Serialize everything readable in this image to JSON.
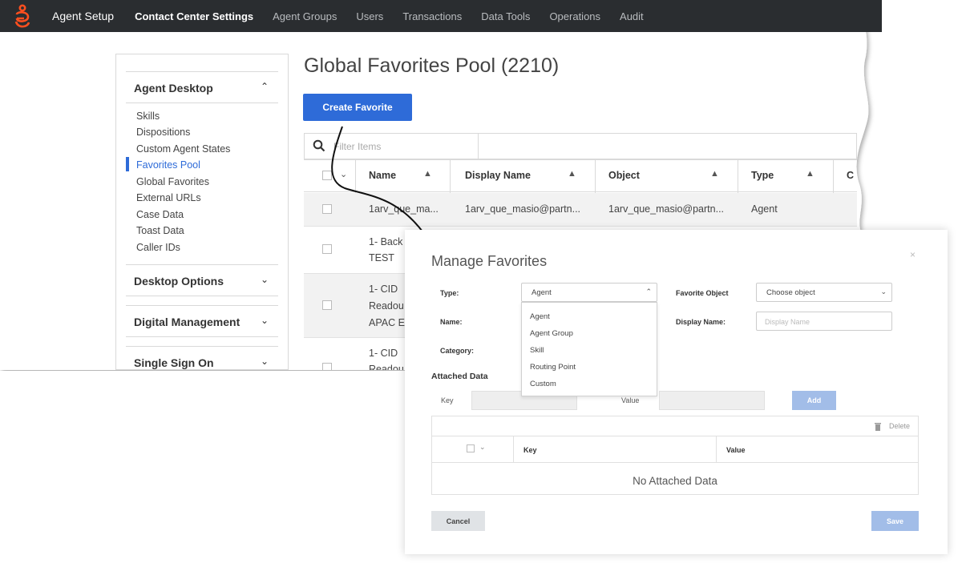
{
  "topbar": {
    "app_name": "Agent Setup",
    "items": [
      "Contact Center Settings",
      "Agent Groups",
      "Users",
      "Transactions",
      "Data Tools",
      "Operations",
      "Audit"
    ],
    "background": "#2a2d30",
    "logo_color": "#ff4f1f"
  },
  "sidebar": {
    "section_agent_desktop": "Agent Desktop",
    "items": [
      "Skills",
      "Dispositions",
      "Custom Agent States",
      "Favorites Pool",
      "Global Favorites",
      "External URLs",
      "Case Data",
      "Toast Data",
      "Caller IDs"
    ],
    "active_item": "Favorites Pool",
    "section_desktop_options": "Desktop Options",
    "section_digital_management": "Digital Management",
    "section_single_sign_on": "Single Sign On",
    "accent": "#2e6bd8"
  },
  "main": {
    "title": "Global Favorites Pool (2210)",
    "create_button": "Create Favorite",
    "filter_placeholder": "Filter Items",
    "columns": [
      "Name",
      "Display Name",
      "Object",
      "Type",
      "C"
    ],
    "rows": [
      {
        "name": "1arv_que_ma...",
        "display_name": "1arv_que_masio@partn...",
        "object": "1arv_que_masio@partn...",
        "type": "Agent"
      },
      {
        "name_l1": "1- Back",
        "name_l2": "TEST"
      },
      {
        "name_l1": "1- CID",
        "name_l2": "Readou",
        "name_l3": "APAC EI"
      },
      {
        "name_l1": "1- CID",
        "name_l2": "Readou"
      }
    ]
  },
  "modal": {
    "title": "Manage Favorites",
    "close": "×",
    "type_label": "Type:",
    "type_value": "Agent",
    "favorite_object_label": "Favorite Object",
    "favorite_object_value": "Choose object",
    "name_label": "Name:",
    "display_name_label": "Display Name:",
    "display_name_placeholder": "Display Name",
    "category_label": "Category:",
    "type_options": [
      "Agent",
      "Agent Group",
      "Skill",
      "Routing Point",
      "Custom"
    ],
    "attached_data_title": "Attached Data",
    "key_label": "Key",
    "value_label": "Value",
    "add_button": "Add",
    "delete_label": "Delete",
    "table_key": "Key",
    "table_value": "Value",
    "empty_text": "No Attached Data",
    "cancel_button": "Cancel",
    "save_button": "Save"
  }
}
